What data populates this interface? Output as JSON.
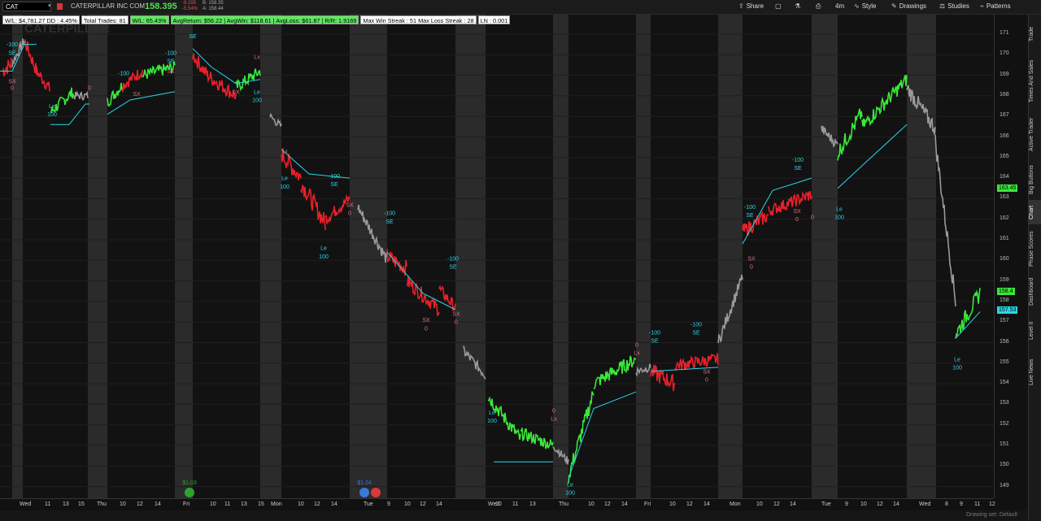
{
  "header": {
    "symbol": "CAT",
    "company": "CATERPILLAR INC COM",
    "last": "158.395",
    "change": "-9.295",
    "change_pct": "-5.54%",
    "bid": "B: 158.35",
    "ask": "A: 158.44",
    "watermark": "CATERPILLAR"
  },
  "toolbar": {
    "share": "Share",
    "timeframe": "4m",
    "style": "Style",
    "drawings": "Drawings",
    "studies": "Studies",
    "patterns": "Patterns"
  },
  "stats": {
    "wl_amount": "W/L: $4,781.27   DD : 4.45%",
    "total_trades": "Total Trades: 81",
    "wl_pct": "W/L: 65.43%",
    "summary": "AvgReturn: $56.22 | AvgWin: $118.61 | AvgLoss: $61.87 | R/R: 1.9169",
    "streak": "Max Win Streak : 51 Max Loss Streak : 28",
    "ln": "LN  : 0.001"
  },
  "price_axis": {
    "ticks": [
      "171",
      "170",
      "169",
      "168",
      "167",
      "166",
      "165",
      "164",
      "163",
      "162",
      "161",
      "160",
      "159",
      "158",
      "157",
      "156",
      "155",
      "154",
      "153",
      "152",
      "151",
      "150",
      "149"
    ],
    "tag_green_1": "163.45",
    "tag_green_2": "158.4",
    "tag_cyan": "157.53",
    "colors": {
      "green": "#39e83a",
      "cyan": "#2bd6e8",
      "red": "#e8202a",
      "grey": "#9a9a9a"
    }
  },
  "time_axis": [
    "Wed",
    "11",
    "13",
    "15",
    "Thu",
    "10",
    "12",
    "14",
    "Fri",
    "10",
    "11",
    "13",
    "15",
    "Mon",
    "10",
    "12",
    "14",
    "Tue",
    "9",
    "10",
    "12",
    "14",
    "Wed",
    "10",
    "11",
    "13",
    "Thu",
    "10",
    "12",
    "14",
    "Fri",
    "10",
    "12",
    "14",
    "Mon",
    "10",
    "12",
    "14",
    "Tue",
    "9",
    "10",
    "12",
    "14",
    "Wed",
    "8",
    "9",
    "11",
    "12"
  ],
  "right_tabs": [
    "Trade",
    "Times And Sales",
    "Active Trader",
    "Big Buttons",
    "Chart",
    "Phase Scores",
    "Dashboard",
    "Level II",
    "Live News"
  ],
  "events": {
    "div1": "$1.03",
    "div2": "$1.24"
  },
  "signals": {
    "le": "Le",
    "se": "SE",
    "sx": "SX",
    "lx": "Lx",
    "q100": "100",
    "qn100": "-100",
    "q0": "0"
  },
  "footer": {
    "drawing_set": "Drawing set: Default"
  }
}
